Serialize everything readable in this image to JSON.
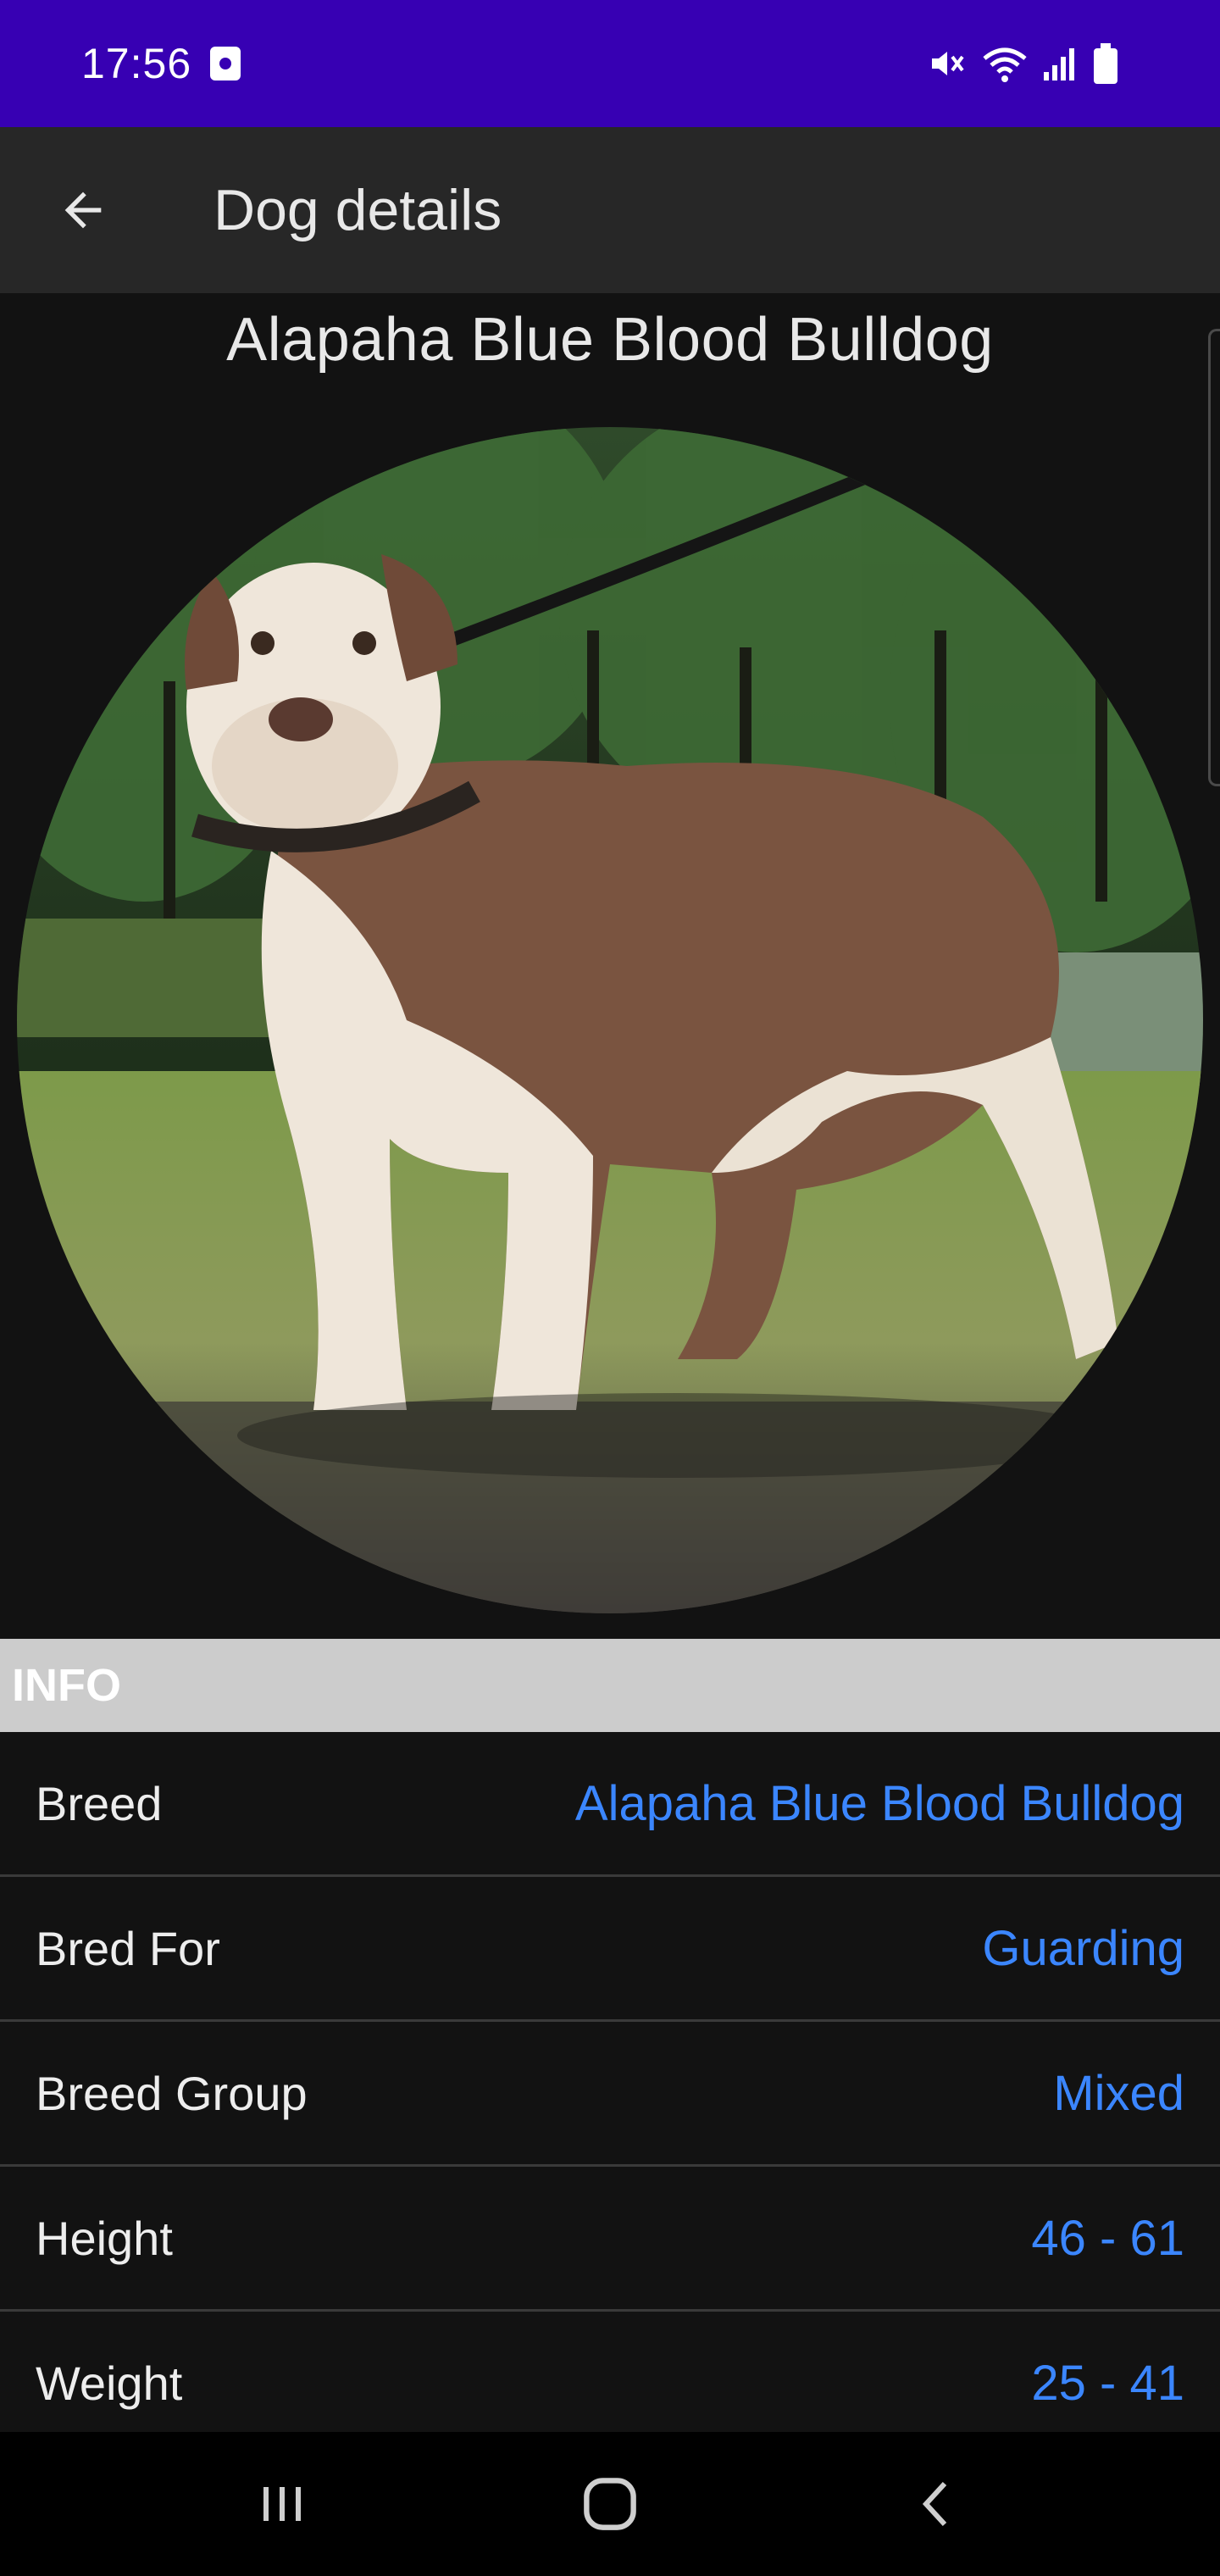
{
  "status_bar": {
    "time": "17:56",
    "icons": [
      "screen-record-icon",
      "mute-icon",
      "wifi-icon",
      "signal-icon",
      "battery-icon"
    ],
    "background": "#3700b3"
  },
  "app_bar": {
    "title": "Dog details",
    "back_icon": "arrow-back-icon",
    "background": "#272727"
  },
  "dog": {
    "name": "Alapaha Blue Blood Bulldog",
    "photo_description_icon": "dog-photo"
  },
  "info_section": {
    "header": "INFO",
    "rows": [
      {
        "label": "Breed",
        "value": "Alapaha Blue Blood Bulldog"
      },
      {
        "label": "Bred For",
        "value": "Guarding"
      },
      {
        "label": "Breed Group",
        "value": "Mixed"
      },
      {
        "label": "Height",
        "value": "46 - 61"
      },
      {
        "label": "Weight",
        "value": "25 - 41"
      }
    ],
    "value_color": "#3b86ff"
  },
  "nav_bar": {
    "buttons": [
      "recents-icon",
      "home-icon",
      "back-icon"
    ]
  }
}
